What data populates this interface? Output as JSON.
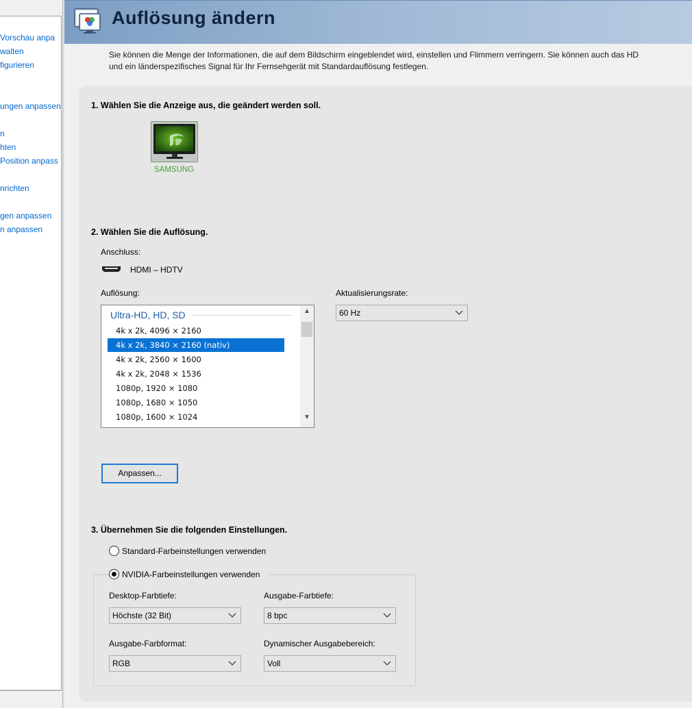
{
  "sidebar": {
    "items": [
      {
        "label": "Vorschau anpa"
      },
      {
        "label": "walten"
      },
      {
        "label": "figurieren"
      },
      {
        "label": "ungen anpassen"
      },
      {
        "label": "n"
      },
      {
        "label": "hten"
      },
      {
        "label": "Position anpass"
      },
      {
        "label": "nrichten"
      },
      {
        "label": "gen anpassen"
      },
      {
        "label": "n anpassen"
      }
    ]
  },
  "header": {
    "title": "Auflösung ändern"
  },
  "intro": {
    "line1": "Sie können die Menge der Informationen, die auf dem Bildschirm eingeblendet wird, einstellen und Flimmern verringern. Sie können auch das HD",
    "line2": "und ein länderspezifisches Signal für Ihr Fernsehgerät mit Standardauflösung festlegen."
  },
  "step1": {
    "title": "1. Wählen Sie die Anzeige aus, die geändert werden soll.",
    "display_name": "SAMSUNG"
  },
  "step2": {
    "title": "2. Wählen Sie die Auflösung.",
    "connection_label": "Anschluss:",
    "connection_value": "HDMI – HDTV",
    "resolution_label": "Auflösung:",
    "refresh_label": "Aktualisierungsrate:",
    "refresh_value": "60 Hz",
    "list_group": "Ultra-HD, HD, SD",
    "resolutions": [
      "4k x 2k, 4096 × 2160",
      "4k x 2k, 3840 × 2160 (nativ)",
      "4k x 2k, 2560 × 1600",
      "4k x 2k, 2048 × 1536",
      "1080p, 1920 × 1080",
      "1080p, 1680 × 1050",
      "1080p, 1600 × 1024"
    ],
    "selected_resolution": "4k x 2k, 3840 × 2160 (nativ)",
    "customize_label": "Anpassen..."
  },
  "step3": {
    "title": "3. Übernehmen Sie die folgenden Einstellungen.",
    "radio_default": "Standard-Farbeinstellungen verwenden",
    "radio_nvidia": "NVIDIA-Farbeinstellungen verwenden",
    "selected_option": "NVIDIA-Farbeinstellungen verwenden",
    "desktop_depth_label": "Desktop-Farbtiefe:",
    "desktop_depth_value": "Höchste (32 Bit)",
    "output_depth_label": "Ausgabe-Farbtiefe:",
    "output_depth_value": "8 bpc",
    "output_format_label": "Ausgabe-Farbformat:",
    "output_format_value": "RGB",
    "dynamic_range_label": "Dynamischer Ausgabebereich:",
    "dynamic_range_value": "Voll"
  },
  "colors": {
    "link": "#0066cc",
    "selection": "#0a72d4",
    "display_label": "#46a03c",
    "header_start": "#7d9ec4",
    "header_end": "#b7cae1"
  },
  "icons": {
    "header": "display-settings-icon",
    "display": "nvidia-monitor-icon",
    "connection": "hdmi-connector-icon"
  }
}
